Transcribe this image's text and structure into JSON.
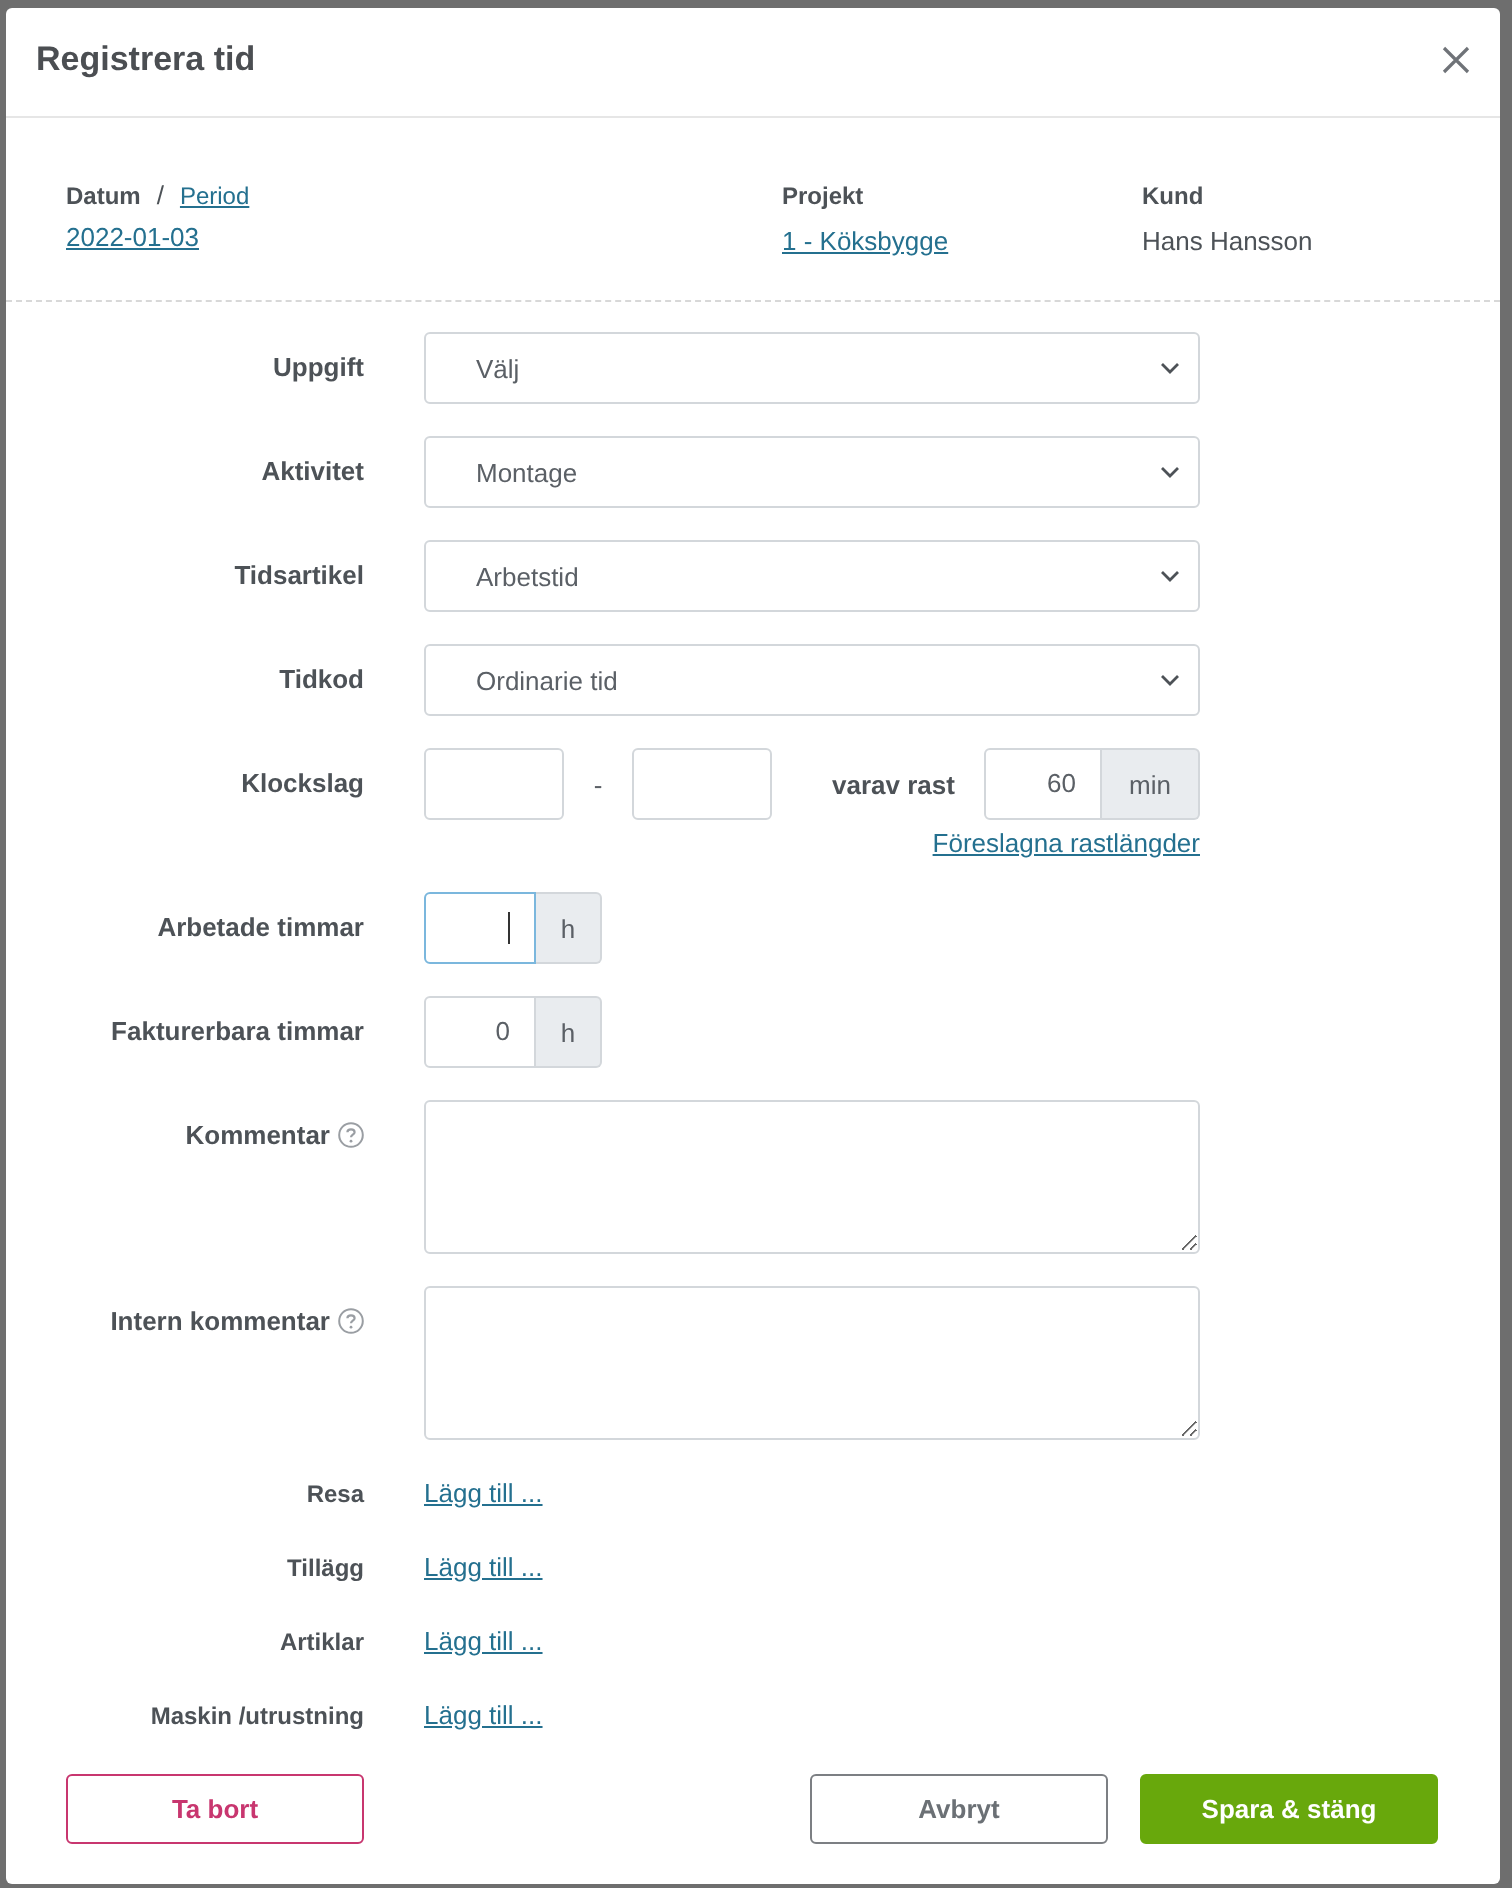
{
  "dialog": {
    "title": "Registrera tid"
  },
  "info": {
    "date_label": "Datum",
    "separator": "/",
    "period_link": "Period",
    "date": "2022-01-03",
    "project_label": "Projekt",
    "project": "1 - Köksbygge",
    "customer_label": "Kund",
    "customer": "Hans Hansson"
  },
  "fields": [
    {
      "kind": "select",
      "label": "Uppgift",
      "value": "Välj"
    },
    {
      "kind": "select",
      "label": "Aktivitet",
      "value": "Montage"
    },
    {
      "kind": "select",
      "label": "Tidsartikel",
      "value": "Arbetstid"
    },
    {
      "kind": "select",
      "label": "Tidkod",
      "value": "Ordinarie tid"
    },
    {
      "kind": "time_range",
      "label": "Klockslag",
      "separator": "-",
      "break_label": "varav rast",
      "break_value": "60",
      "break_unit": "min",
      "link": "Föreslagna rastlängder"
    },
    {
      "kind": "hours",
      "label": "Arbetade timmar",
      "unit": "h",
      "focused": true
    },
    {
      "kind": "hours",
      "label": "Fakturerbara timmar",
      "value": "0",
      "unit": "h",
      "focused": false
    },
    {
      "kind": "textarea",
      "label": "Kommentar",
      "help": true
    },
    {
      "kind": "textarea",
      "label": "Intern kommentar",
      "help": true
    },
    {
      "kind": "add",
      "label": "Resa",
      "link": "Lägg till ..."
    },
    {
      "kind": "add",
      "label": "Tillägg",
      "link": "Lägg till ..."
    },
    {
      "kind": "add",
      "label": "Artiklar",
      "link": "Lägg till ..."
    },
    {
      "kind": "add",
      "label": "Maskin /utrustning",
      "link": "Lägg till ..."
    }
  ],
  "buttons": [
    {
      "label": "Ta bort",
      "kind": "danger"
    },
    {
      "label": "Avbryt",
      "kind": "secondary"
    },
    {
      "label": "Spara & stäng",
      "kind": "primary"
    }
  ]
}
